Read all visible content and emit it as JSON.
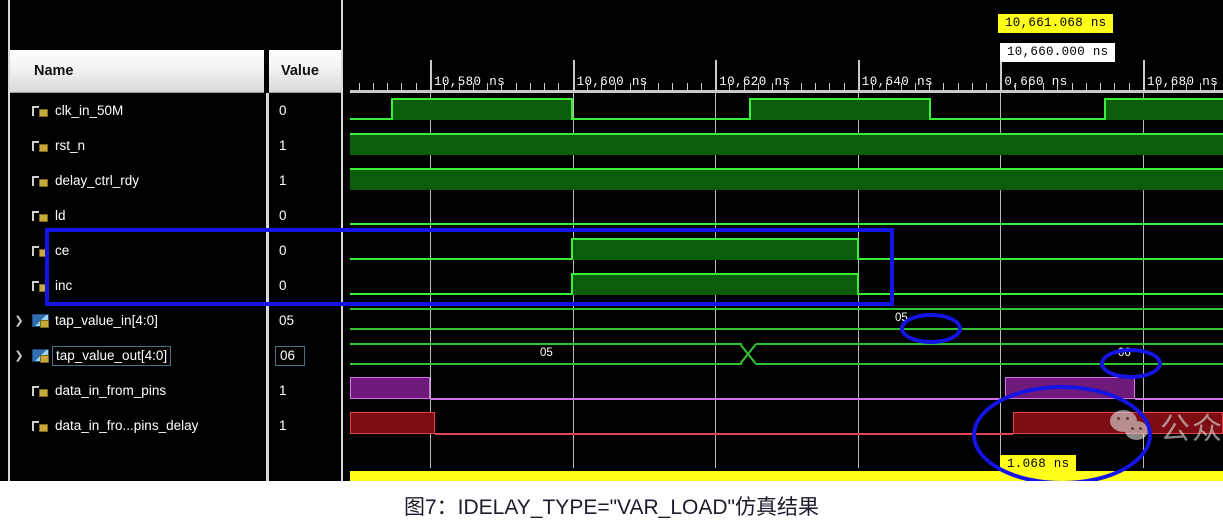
{
  "panel": {
    "columns": {
      "name": "Name",
      "value": "Value"
    },
    "signals": [
      {
        "name": "clk_in_50M",
        "value": "0",
        "kind": "bit",
        "expandable": false,
        "selected": false
      },
      {
        "name": "rst_n",
        "value": "1",
        "kind": "bit",
        "expandable": false,
        "selected": false
      },
      {
        "name": "delay_ctrl_rdy",
        "value": "1",
        "kind": "bit",
        "expandable": false,
        "selected": false
      },
      {
        "name": "ld",
        "value": "0",
        "kind": "bit",
        "expandable": false,
        "selected": false
      },
      {
        "name": "ce",
        "value": "0",
        "kind": "bit",
        "expandable": false,
        "selected": false
      },
      {
        "name": "inc",
        "value": "0",
        "kind": "bit",
        "expandable": false,
        "selected": false
      },
      {
        "name": "tap_value_in[4:0]",
        "value": "05",
        "kind": "bus",
        "expandable": true,
        "selected": false
      },
      {
        "name": "tap_value_out[4:0]",
        "value": "06",
        "kind": "bus",
        "expandable": true,
        "selected": true
      },
      {
        "name": "data_in_from_pins",
        "value": "1",
        "kind": "bit",
        "expandable": false,
        "selected": false
      },
      {
        "name": "data_in_fro...pins_delay",
        "value": "1",
        "kind": "bit",
        "expandable": false,
        "selected": false
      }
    ]
  },
  "timeline": {
    "unit": "ns",
    "major_ticks": [
      "10,580 ns",
      "10,600 ns",
      "10,620 ns",
      "10,640 ns",
      "0,660 ns",
      "10,680 ns"
    ],
    "minor_per_major": 10
  },
  "cursors": {
    "primary_label": "10,661.068 ns",
    "secondary_label": "10,660.000 ns",
    "delta_label": "1.068 ns"
  },
  "wave_labels": {
    "tap_in_value": "05",
    "tap_out_value_before": "05",
    "tap_out_value_after": "06"
  },
  "annotations": {
    "highlight_color": "#1414e6",
    "ellipse_05": "05",
    "ellipse_06": "06"
  },
  "watermark": {
    "text": "公众号 · FPGA技术实战"
  },
  "caption": {
    "text": "图7：IDELAY_TYPE=\"VAR_LOAD\"仿真结果"
  },
  "colors": {
    "background": "#000000",
    "wave_green": "#38f038",
    "wave_green_fill": "#0b5c0b",
    "bus_green": "#2fc42f",
    "purple": "#d36fe8",
    "red": "#e0454c",
    "cursor_yellow": "#ffff1a",
    "cursor_white": "#f2f2f2",
    "grid": "#b9b9b9"
  }
}
